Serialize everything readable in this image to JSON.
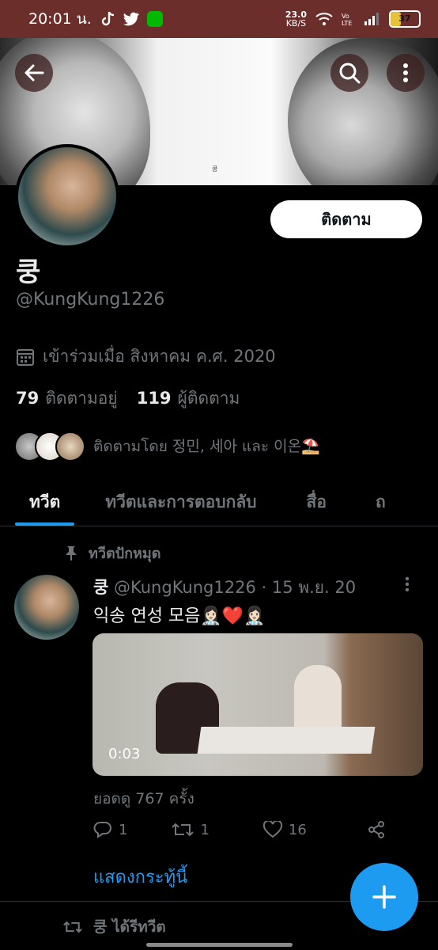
{
  "status_bar": {
    "time": "20:01 น.",
    "net_speed": "23.0",
    "net_unit": "KB/S",
    "battery": "37",
    "battery_level": 0.37
  },
  "profile": {
    "follow_label": "ติดตาม",
    "display_name": "쿵",
    "handle": "@KungKung1226",
    "joined": "เข้าร่วมเมื่อ สิงหาคม ค.ศ. 2020",
    "following_count": "79",
    "following_label": "ติดตามอยู่",
    "followers_count": "119",
    "followers_label": "ผู้ติดตาม",
    "followed_by": "ติดตามโดย 정민, 세아 และ 이온⛱️"
  },
  "tabs": [
    {
      "label": "ทวีต"
    },
    {
      "label": "ทวีตและการตอบกลับ"
    },
    {
      "label": "สื่อ"
    },
    {
      "label": "ถ"
    }
  ],
  "tweet": {
    "pinned_label": "ทวีตปักหมุด",
    "name": "쿵",
    "handle_date": "@KungKung1226 · 15 พ.ย. 20",
    "text": "익송 연성 모음👩🏻‍⚕️❤️👩🏻‍⚕️",
    "video_time": "0:03",
    "views": "ยอดดู 767 ครั้ง",
    "replies": "1",
    "retweets": "1",
    "likes": "16",
    "show_thread": "แสดงกระทู้นี้"
  },
  "next_item": {
    "retweeted_label": "쿵 ได้รีทวีต"
  },
  "colors": {
    "accent": "#1d9bf0",
    "background": "#000000",
    "statusbar": "#6b2e2a"
  },
  "fab": {
    "icon": "plus-icon"
  }
}
